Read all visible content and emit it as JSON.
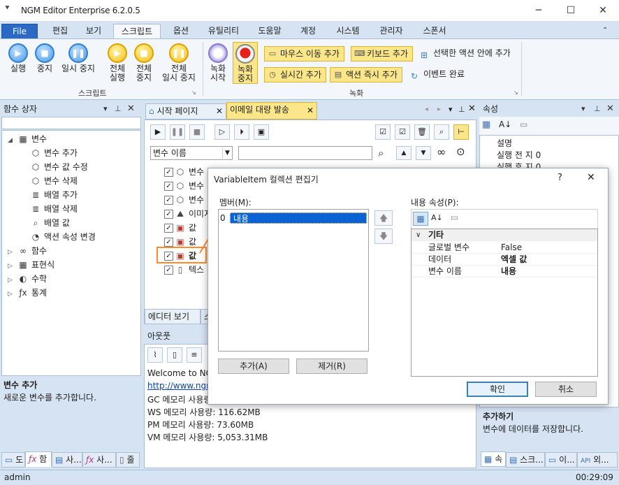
{
  "window": {
    "title": "NGM Editor   Enterprise 6.2.0.5",
    "minimize": "─",
    "maximize": "☐",
    "close": "✕"
  },
  "menu": {
    "file": "File",
    "tabs": [
      "편집",
      "보기",
      "스크립트",
      "옵션",
      "유틸리티",
      "도움말",
      "계정",
      "시스템",
      "관리자",
      "스폰서"
    ],
    "active": "스크립트"
  },
  "ribbon": {
    "script_group": "스크립트",
    "record_group": "녹화",
    "run": "실행",
    "stop": "중지",
    "pause": "일시 중지",
    "all_run": [
      "전체",
      "실행"
    ],
    "all_stop": [
      "전체",
      "중지"
    ],
    "all_pause": [
      "전체",
      "일시 중지"
    ],
    "rec_start": [
      "녹화",
      "시작"
    ],
    "rec_stop": [
      "녹화",
      "중지"
    ],
    "mouse_move": "마우스 이동 추가",
    "keyboard": "키보드 추가",
    "inside_action": "선택한 액션 안에 추가",
    "realtime": "실시간 추가",
    "action_now": "액션 즉시 추가",
    "event_done": "이벤트 완료"
  },
  "left_panel": {
    "title": "함수 상자",
    "tree": [
      {
        "label": "변수",
        "icon": "▦",
        "level": 0,
        "expander": "◢"
      },
      {
        "label": "변수 추가",
        "icon": "⬡",
        "level": 1
      },
      {
        "label": "변수 값 수정",
        "icon": "⬡",
        "level": 1
      },
      {
        "label": "변수 삭제",
        "icon": "⬡",
        "level": 1
      },
      {
        "label": "배열 추가",
        "icon": "≣",
        "level": 1
      },
      {
        "label": "배열 삭제",
        "icon": "≣",
        "level": 1
      },
      {
        "label": "배열 값",
        "icon": "⌕",
        "level": 1
      },
      {
        "label": "액션 속성 변경",
        "icon": "◔",
        "level": 1
      },
      {
        "label": "함수",
        "icon": "∞",
        "level": 0,
        "expander": "▷"
      },
      {
        "label": "표현식",
        "icon": "▦",
        "level": 0,
        "expander": "▷"
      },
      {
        "label": "수학",
        "icon": "◐",
        "level": 0,
        "expander": "▷"
      },
      {
        "label": "통계",
        "icon": "ƒx",
        "level": 0,
        "expander": "▷"
      }
    ],
    "desc_title": "변수 추가",
    "desc_text": "새로운 변수를 추가합니다.",
    "bottom_tabs": [
      "도",
      "함",
      "사...",
      "사...",
      "줄"
    ]
  },
  "doc_tabs": {
    "start": "시작 페이지",
    "active": "이메일 대량 발송"
  },
  "editor": {
    "var_select": "변수 이름",
    "rows": [
      {
        "label": "변수 ",
        "type": "var"
      },
      {
        "label": "변수",
        "type": "var"
      },
      {
        "label": "변수",
        "type": "var"
      },
      {
        "label": "이미지",
        "type": "img"
      },
      {
        "label": "값",
        "type": "val"
      },
      {
        "label": "값",
        "type": "val"
      },
      {
        "label": "값",
        "type": "val"
      },
      {
        "label": "텍스",
        "type": "txt"
      }
    ],
    "bottom_tab": "에디터 보기",
    "bottom_tab2": "스"
  },
  "output": {
    "title": "아웃풋",
    "lines": [
      "Welcome to NGM",
      "http://www.ngm",
      "GC 메모리 사용량:",
      "WS 메모리 사용량: 116.62MB",
      "PM 메모리 사용량: 73.60MB",
      "VM 메모리 사용량: 5,053.31MB"
    ]
  },
  "right_panel": {
    "title": "속성",
    "rows": [
      "설명",
      "실행 전 지 0",
      "실행 후 지 0"
    ],
    "desc_title": "추가하기",
    "desc_text": "변수에 데이터를 저장합니다.",
    "bottom_tabs": [
      "속",
      "스크...",
      "이...",
      "외..."
    ]
  },
  "dialog": {
    "title": "VariableItem 컬렉션 편집기",
    "help": "?",
    "close": "✕",
    "members_label": "멤버(M):",
    "member_index": "0",
    "member_item": "내용",
    "props_label": "내용 속성(P):",
    "category": "기타",
    "props": [
      {
        "key": "글로벌 변수",
        "value": "False",
        "bold": false
      },
      {
        "key": "데이터",
        "value": "엑셀 값",
        "bold": true
      },
      {
        "key": "변수 이름",
        "value": "내용",
        "bold": true
      }
    ],
    "add": "추가(A)",
    "remove": "제거(R)",
    "ok": "확인",
    "cancel": "취소"
  },
  "status": {
    "user": "admin",
    "time": "00:29:09"
  },
  "colors": {
    "accent": "#2b69c5",
    "highlight": "#ff8a2a",
    "selection": "#0a63d4",
    "ribbon_yellow": "#fbe789"
  }
}
